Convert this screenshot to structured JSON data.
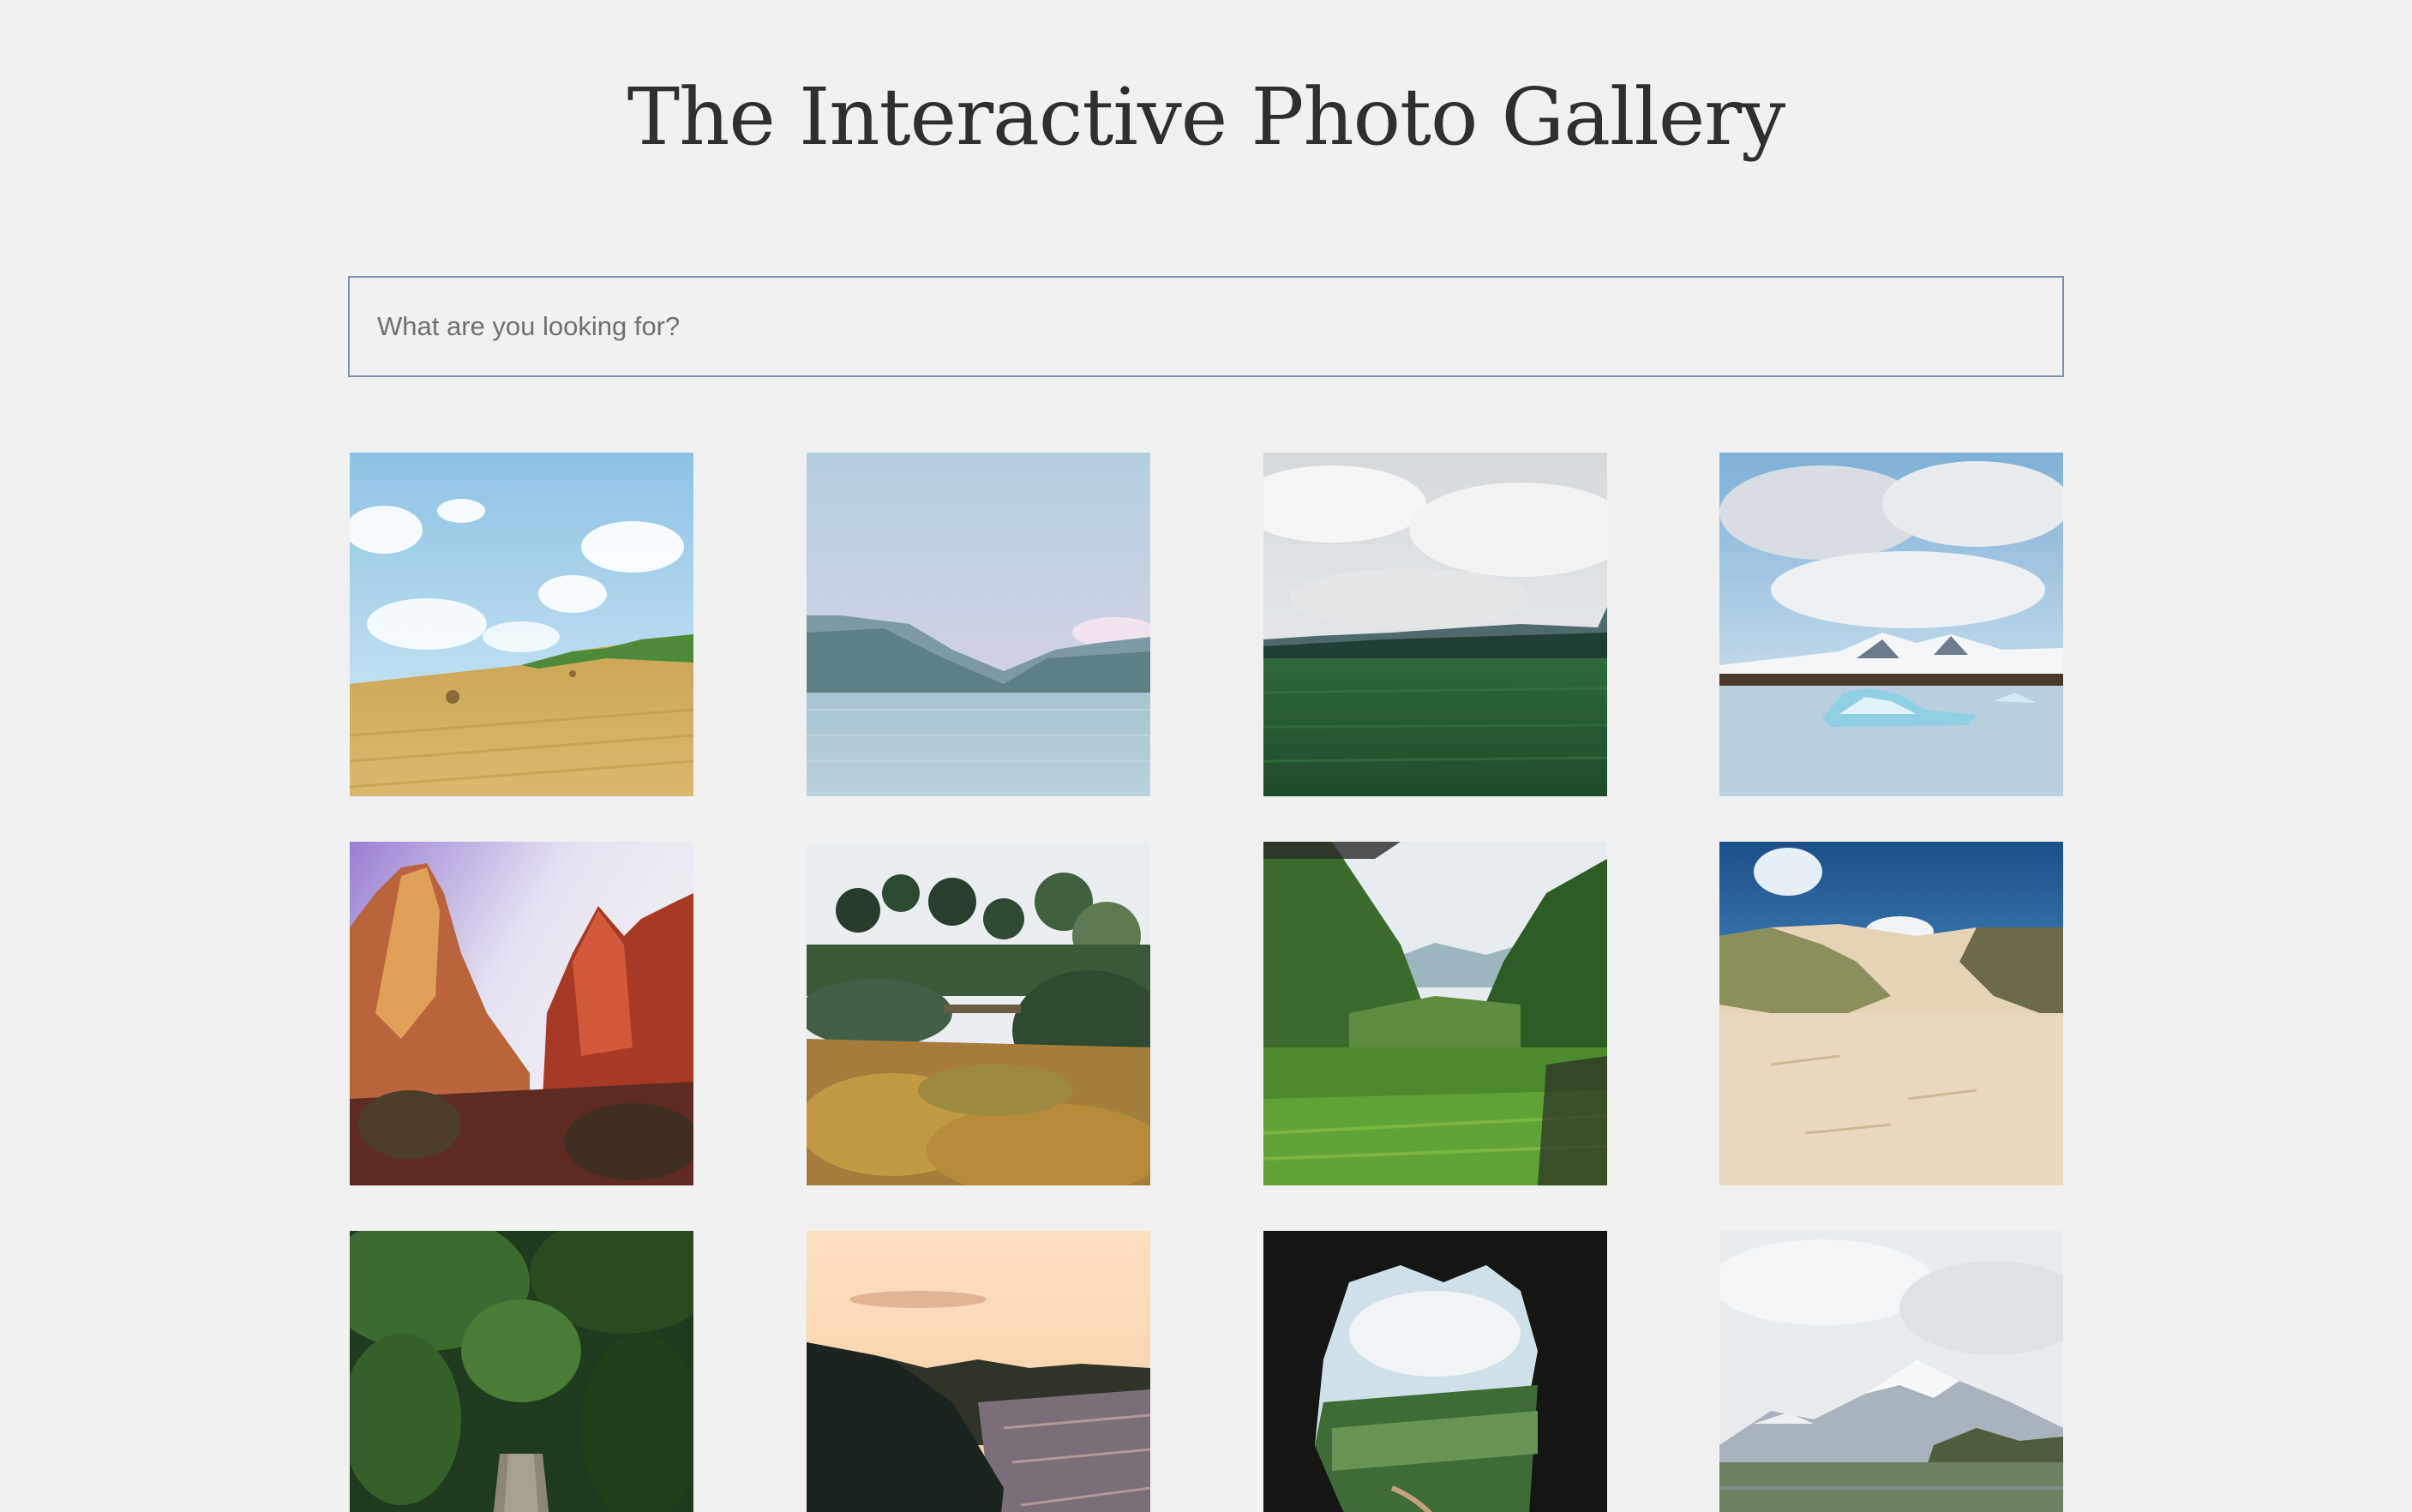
{
  "page": {
    "title": "The Interactive Photo Gallery",
    "background": "#f1f1f1"
  },
  "search": {
    "placeholder": "What are you looking for?",
    "value": "",
    "border_color": "#7f8fab"
  },
  "gallery": {
    "photos": [
      {
        "name": "photo-wheat-field"
      },
      {
        "name": "photo-mountain-lake"
      },
      {
        "name": "photo-green-meadow-clouds"
      },
      {
        "name": "photo-glacier-lagoon"
      },
      {
        "name": "photo-red-rock-canyon"
      },
      {
        "name": "photo-autumn-garden"
      },
      {
        "name": "photo-green-valley"
      },
      {
        "name": "photo-sand-dunes"
      },
      {
        "name": "photo-forest-path"
      },
      {
        "name": "photo-coastal-sunset"
      },
      {
        "name": "photo-cave-view"
      },
      {
        "name": "photo-snowy-mountain-field"
      }
    ]
  }
}
